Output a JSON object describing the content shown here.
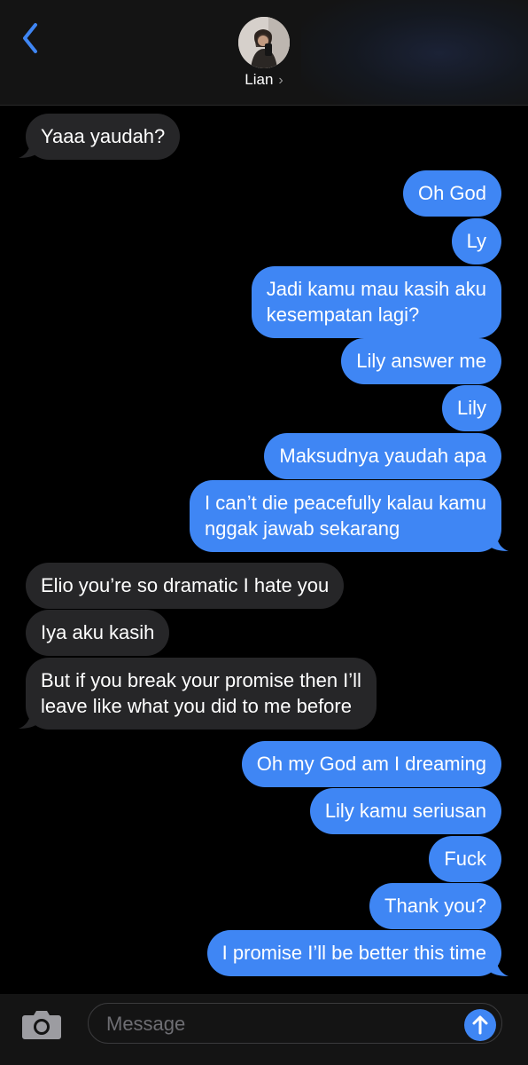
{
  "header": {
    "contact_name": "Lian",
    "chevron": "›",
    "back_icon": "chevron-left-icon",
    "accent_color": "#3f86f4"
  },
  "messages": [
    {
      "direction": "incoming",
      "text": "Yaaa yaudah?"
    },
    {
      "direction": "outgoing",
      "text": "Oh God"
    },
    {
      "direction": "outgoing",
      "text": "Ly"
    },
    {
      "direction": "outgoing",
      "lines": [
        "Jadi kamu mau kasih aku",
        "kesempatan lagi?"
      ]
    },
    {
      "direction": "outgoing",
      "text": "Lily answer me"
    },
    {
      "direction": "outgoing",
      "text": "Lily"
    },
    {
      "direction": "outgoing",
      "text": "Maksudnya yaudah apa"
    },
    {
      "direction": "outgoing",
      "lines": [
        "I can’t die peacefully kalau kamu",
        "nggak jawab sekarang"
      ]
    },
    {
      "direction": "incoming",
      "text": "Elio you’re so dramatic I hate you"
    },
    {
      "direction": "incoming",
      "text": "Iya aku kasih"
    },
    {
      "direction": "incoming",
      "lines": [
        "But if you break your promise then I’ll",
        "leave like what you did to me before"
      ]
    },
    {
      "direction": "outgoing",
      "text": "Oh my God am I dreaming"
    },
    {
      "direction": "outgoing",
      "text": "Lily kamu seriusan"
    },
    {
      "direction": "outgoing",
      "text": "Fuck"
    },
    {
      "direction": "outgoing",
      "text": "Thank you?"
    },
    {
      "direction": "outgoing",
      "text": "I promise I’ll be better this time"
    }
  ],
  "composer": {
    "placeholder": "Message",
    "camera_icon": "camera-icon",
    "send_icon": "arrow-up-icon"
  },
  "colors": {
    "incoming_bubble": "#262628",
    "outgoing_bubble": "#3f86f4",
    "background": "#000000"
  }
}
